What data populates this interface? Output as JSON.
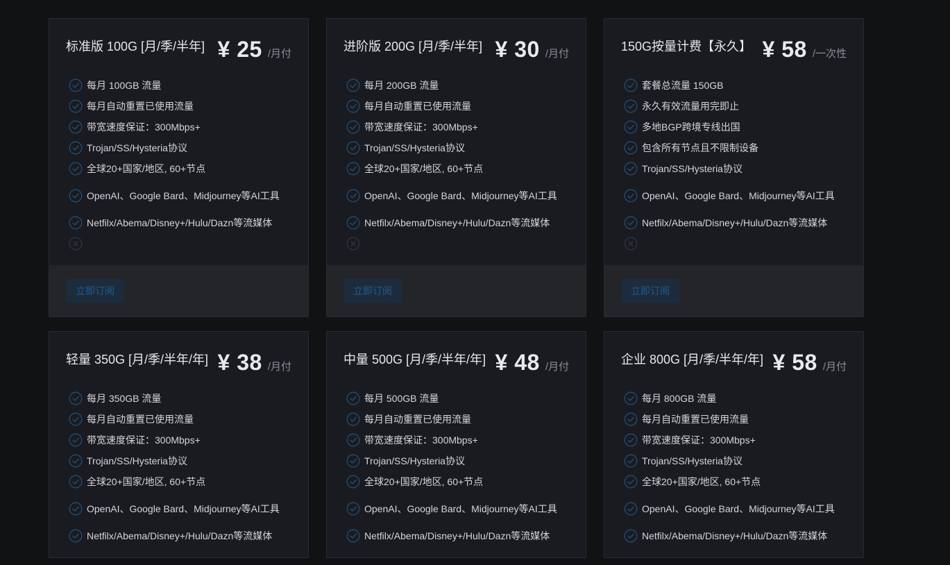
{
  "colors": {
    "check": "#1f4e79",
    "cross": "#2f3340",
    "button_text": "#1f5b92"
  },
  "plans": [
    {
      "title": "标准版 100G [月/季/半年]",
      "price": "¥ 25",
      "unit": "/月付",
      "button": "立即订阅",
      "features": [
        {
          "text": "每月 100GB 流量",
          "icon": "check-circle-icon"
        },
        {
          "text": "每月自动重置已使用流量",
          "icon": "check-circle-icon"
        },
        {
          "text": "带宽速度保证：300Mbps+",
          "icon": "check-circle-icon"
        },
        {
          "text": "Trojan/SS/Hysteria协议",
          "icon": "check-circle-icon"
        },
        {
          "text": "全球20+国家/地区, 60+节点",
          "icon": "check-circle-icon"
        },
        {
          "text": "OpenAI、Google Bard、Midjourney等AI工具",
          "icon": "check-circle-icon",
          "two_line": true
        },
        {
          "text": "Netfilx/Abema/Disney+/Hulu/Dazn等流媒体",
          "icon": "check-circle-icon"
        },
        {
          "text": "",
          "icon": "cross-circle-icon"
        }
      ]
    },
    {
      "title": "进阶版 200G [月/季/半年]",
      "price": "¥ 30",
      "unit": "/月付",
      "button": "立即订阅",
      "features": [
        {
          "text": "每月 200GB 流量",
          "icon": "check-circle-icon"
        },
        {
          "text": "每月自动重置已使用流量",
          "icon": "check-circle-icon"
        },
        {
          "text": "带宽速度保证：300Mbps+",
          "icon": "check-circle-icon"
        },
        {
          "text": "Trojan/SS/Hysteria协议",
          "icon": "check-circle-icon"
        },
        {
          "text": "全球20+国家/地区, 60+节点",
          "icon": "check-circle-icon"
        },
        {
          "text": "OpenAI、Google Bard、Midjourney等AI工具",
          "icon": "check-circle-icon",
          "two_line": true
        },
        {
          "text": "Netfilx/Abema/Disney+/Hulu/Dazn等流媒体",
          "icon": "check-circle-icon"
        },
        {
          "text": "",
          "icon": "cross-circle-icon"
        }
      ]
    },
    {
      "title": "150G按量计费【永久】",
      "price": "¥ 58",
      "unit": "/一次性",
      "button": "立即订阅",
      "features": [
        {
          "text": "套餐总流量 150GB",
          "icon": "check-circle-icon"
        },
        {
          "text": "永久有效流量用完即止",
          "icon": "check-circle-icon"
        },
        {
          "text": "多地BGP跨境专线出国",
          "icon": "check-circle-icon"
        },
        {
          "text": "包含所有节点且不限制设备",
          "icon": "check-circle-icon"
        },
        {
          "text": "Trojan/SS/Hysteria协议",
          "icon": "check-circle-icon"
        },
        {
          "text": "OpenAI、Google Bard、Midjourney等AI工具",
          "icon": "check-circle-icon",
          "two_line": true
        },
        {
          "text": "Netfilx/Abema/Disney+/Hulu/Dazn等流媒体",
          "icon": "check-circle-icon"
        },
        {
          "text": "",
          "icon": "cross-circle-icon"
        }
      ]
    },
    {
      "title": "轻量 350G [月/季/半年/年]",
      "price": "¥ 38",
      "unit": "/月付",
      "features": [
        {
          "text": "每月 350GB 流量",
          "icon": "check-circle-icon"
        },
        {
          "text": "每月自动重置已使用流量",
          "icon": "check-circle-icon"
        },
        {
          "text": "带宽速度保证：300Mbps+",
          "icon": "check-circle-icon"
        },
        {
          "text": "Trojan/SS/Hysteria协议",
          "icon": "check-circle-icon"
        },
        {
          "text": "全球20+国家/地区, 60+节点",
          "icon": "check-circle-icon"
        },
        {
          "text": "OpenAI、Google Bard、Midjourney等AI工具",
          "icon": "check-circle-icon",
          "two_line": true
        },
        {
          "text": "Netfilx/Abema/Disney+/Hulu/Dazn等流媒体",
          "icon": "check-circle-icon"
        }
      ]
    },
    {
      "title": "中量 500G [月/季/半年/年]",
      "price": "¥ 48",
      "unit": "/月付",
      "features": [
        {
          "text": "每月 500GB 流量",
          "icon": "check-circle-icon"
        },
        {
          "text": "每月自动重置已使用流量",
          "icon": "check-circle-icon"
        },
        {
          "text": "带宽速度保证：300Mbps+",
          "icon": "check-circle-icon"
        },
        {
          "text": "Trojan/SS/Hysteria协议",
          "icon": "check-circle-icon"
        },
        {
          "text": "全球20+国家/地区, 60+节点",
          "icon": "check-circle-icon"
        },
        {
          "text": "OpenAI、Google Bard、Midjourney等AI工具",
          "icon": "check-circle-icon",
          "two_line": true
        },
        {
          "text": "Netfilx/Abema/Disney+/Hulu/Dazn等流媒体",
          "icon": "check-circle-icon"
        }
      ]
    },
    {
      "title": "企业 800G [月/季/半年/年]",
      "price": "¥ 58",
      "unit": "/月付",
      "features": [
        {
          "text": "每月 800GB 流量",
          "icon": "check-circle-icon"
        },
        {
          "text": "每月自动重置已使用流量",
          "icon": "check-circle-icon"
        },
        {
          "text": "带宽速度保证：300Mbps+",
          "icon": "check-circle-icon"
        },
        {
          "text": "Trojan/SS/Hysteria协议",
          "icon": "check-circle-icon"
        },
        {
          "text": "全球20+国家/地区, 60+节点",
          "icon": "check-circle-icon"
        },
        {
          "text": "OpenAI、Google Bard、Midjourney等AI工具",
          "icon": "check-circle-icon",
          "two_line": true
        },
        {
          "text": "Netfilx/Abema/Disney+/Hulu/Dazn等流媒体",
          "icon": "check-circle-icon"
        }
      ]
    }
  ]
}
